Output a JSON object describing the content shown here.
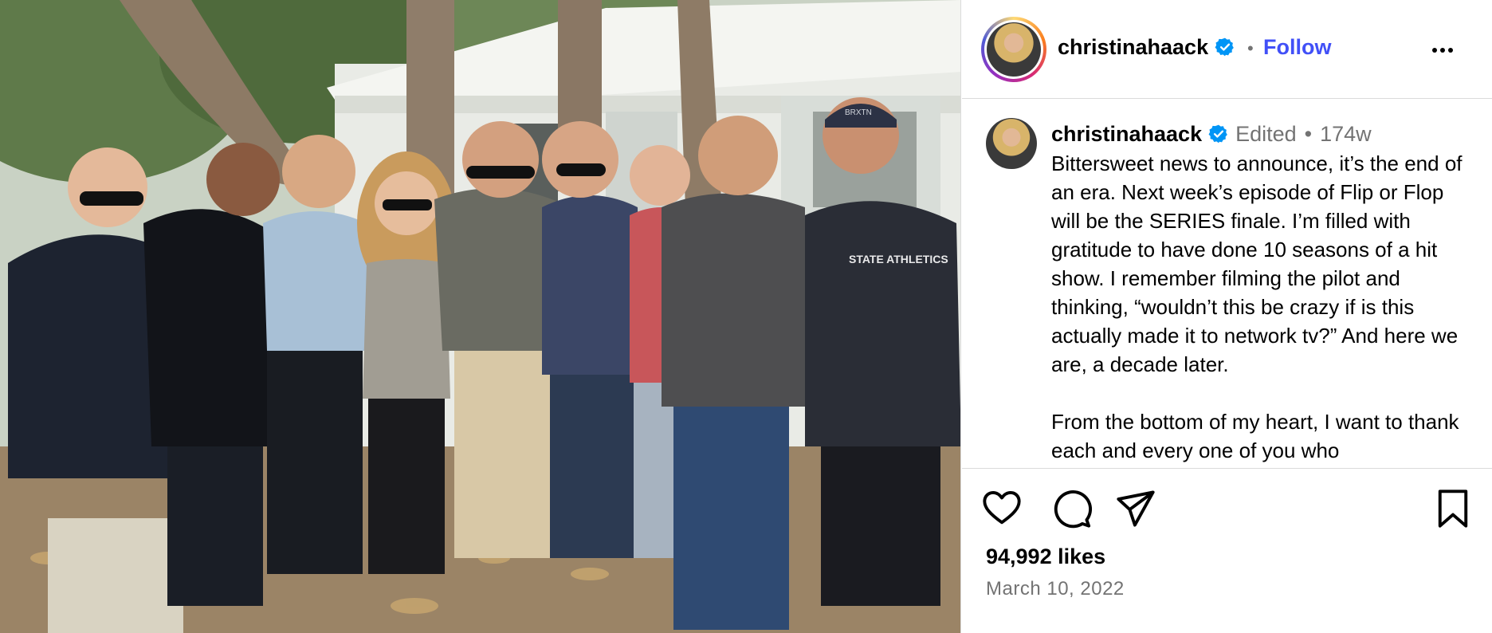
{
  "post": {
    "image": {
      "description_icon": "group-photo",
      "cap_text": "BRXTN",
      "shirt_text": "STATE ATHLETICS"
    }
  },
  "header": {
    "username": "christinahaack",
    "verified_icon": "verified-badge-icon",
    "separator": "•",
    "follow_label": "Follow",
    "more_icon": "more-options-icon"
  },
  "caption": {
    "username": "christinahaack",
    "edited_label": "Edited",
    "separator": "•",
    "age": "174w",
    "text": "Bittersweet news to announce, it’s the end of an era. Next week’s episode of Flip or Flop will be the SERIES finale. I’m filled with gratitude to have done 10 seasons of a hit show. I remember filming the pilot and thinking, “wouldn’t this be crazy if is this actually made it to network tv?” And here we are, a decade later.\n\nFrom the bottom of my heart, I want to thank each and every one of you who"
  },
  "actions": {
    "like_icon": "heart-icon",
    "comment_icon": "comment-icon",
    "share_icon": "share-icon",
    "save_icon": "bookmark-icon"
  },
  "likes": "94,992 likes",
  "date": "March 10, 2022",
  "colors": {
    "follow": "#4150f7",
    "verified": "#0095f6",
    "muted": "#737373",
    "border": "#dbdbdb"
  }
}
